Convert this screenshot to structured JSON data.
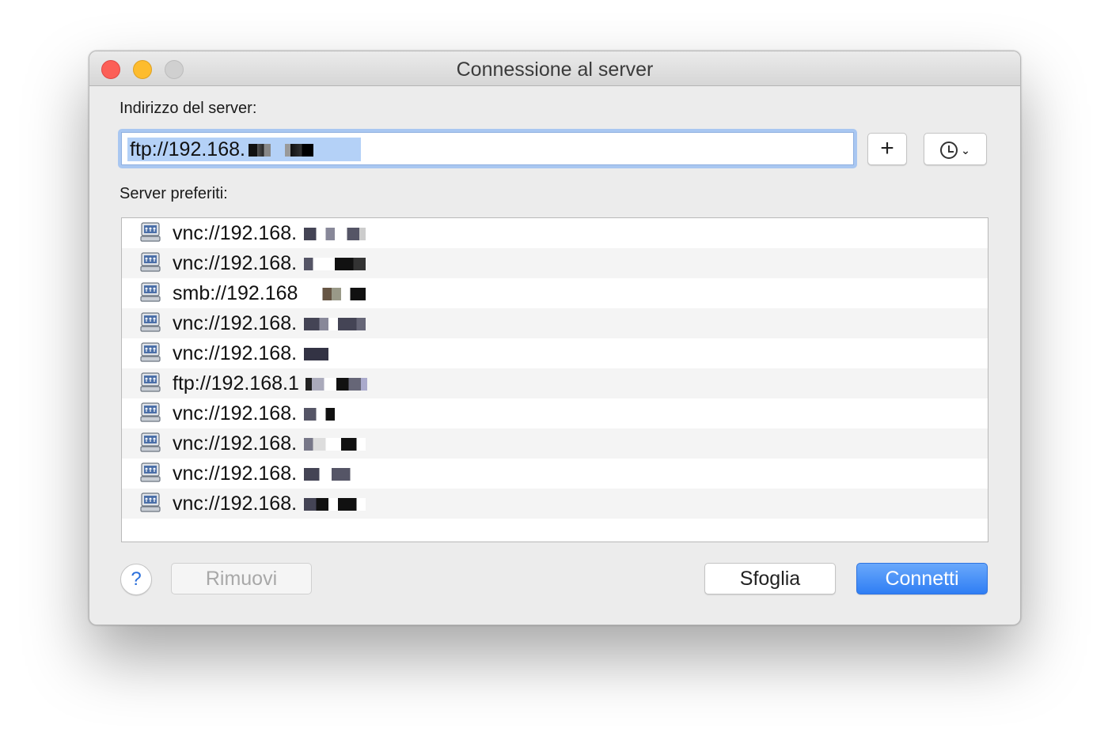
{
  "window": {
    "title": "Connessione al server"
  },
  "address": {
    "label": "Indirizzo del server:",
    "value": "ftp://192.168."
  },
  "favorites": {
    "label": "Server preferiti:",
    "items": [
      {
        "text": "vnc://192.168.",
        "icon": "network-drive-icon"
      },
      {
        "text": "vnc://192.168.",
        "icon": "network-drive-icon"
      },
      {
        "text": "smb://192.168",
        "icon": "network-drive-icon"
      },
      {
        "text": "vnc://192.168.",
        "icon": "network-drive-icon"
      },
      {
        "text": "vnc://192.168.",
        "icon": "network-drive-icon"
      },
      {
        "text": "ftp://192.168.1",
        "icon": "network-drive-icon"
      },
      {
        "text": "vnc://192.168.",
        "icon": "network-drive-icon"
      },
      {
        "text": "vnc://192.168.",
        "icon": "network-drive-icon"
      },
      {
        "text": "vnc://192.168.",
        "icon": "network-drive-icon"
      },
      {
        "text": "vnc://192.168.",
        "icon": "network-drive-icon"
      }
    ]
  },
  "buttons": {
    "add": "+",
    "help": "?",
    "remove": "Rimuovi",
    "browse": "Sfoglia",
    "connect": "Connetti"
  },
  "icons": {
    "history": "clock-icon",
    "history_menu": "chevron-down-icon"
  },
  "colors": {
    "accent": "#3b86f6",
    "selection": "#b4d1f7",
    "close": "#fc5f57",
    "minimize": "#fdbc2e"
  }
}
